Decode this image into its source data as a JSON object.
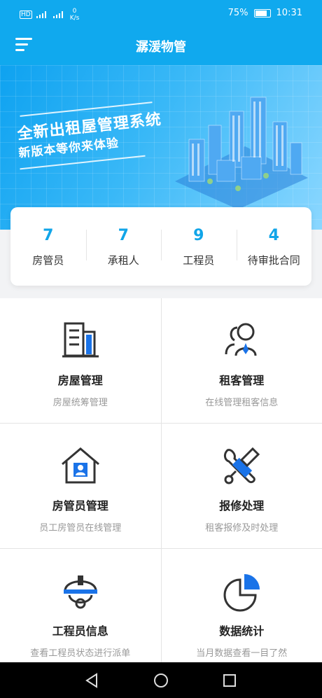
{
  "status_bar": {
    "net_speed": "0",
    "net_unit": "K/s",
    "battery": "75%",
    "time": "10:31"
  },
  "header": {
    "title": "潺湲物管"
  },
  "banner": {
    "headline": "全新出租屋管理系统",
    "subline": "新版本等你来体验"
  },
  "stats": [
    {
      "value": "7",
      "label": "房管员"
    },
    {
      "value": "7",
      "label": "承租人"
    },
    {
      "value": "9",
      "label": "工程员"
    },
    {
      "value": "4",
      "label": "待审批合同"
    }
  ],
  "modules": [
    {
      "title": "房屋管理",
      "subtitle": "房屋统筹管理",
      "icon": "building-icon"
    },
    {
      "title": "租客管理",
      "subtitle": "在线管理租客信息",
      "icon": "tenants-icon"
    },
    {
      "title": "房管员管理",
      "subtitle": "员工房管员在线管理",
      "icon": "house-person-icon"
    },
    {
      "title": "报修处理",
      "subtitle": "租客报修及时处理",
      "icon": "wrench-icon"
    },
    {
      "title": "工程员信息",
      "subtitle": "查看工程员状态进行派单",
      "icon": "helmet-icon"
    },
    {
      "title": "数据统计",
      "subtitle": "当月数据查看一目了然",
      "icon": "pie-chart-icon"
    }
  ],
  "colors": {
    "primary": "#10a9ee",
    "accent": "#1a73e8",
    "dark": "#333333"
  }
}
